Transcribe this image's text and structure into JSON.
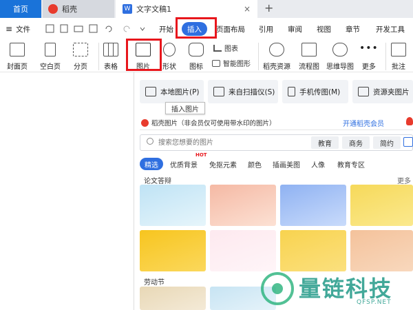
{
  "titlebar": {
    "home_tab": "首页",
    "tabs": [
      {
        "label": "稻壳"
      },
      {
        "label": "文字文稿1",
        "close": "×"
      }
    ],
    "new_tab": "+"
  },
  "menu": {
    "file_label": "文件",
    "items": [
      "开始",
      "插入",
      "页面布局",
      "引用",
      "审阅",
      "视图",
      "章节",
      "开发工具"
    ],
    "active_index": 1
  },
  "ribbon": {
    "buttons": [
      "封面页",
      "空白页",
      "分页",
      "表格",
      "图片",
      "形状",
      "图标",
      "智能图形",
      "稻壳资源",
      "流程图",
      "思维导图",
      "更多",
      "批注"
    ],
    "chart_label": "图表"
  },
  "picture_panel": {
    "sources": [
      "本地图片(P)",
      "来自扫描仪(S)",
      "手机传图(M)",
      "资源夹图片"
    ],
    "tooltip": "插入图片",
    "banner_text": "稻壳图片（非会员仅可使用带水印的图片）",
    "member_link": "开通稻壳会员",
    "search_placeholder": "搜索您想要的图片",
    "search_chips": [
      "教育",
      "商务",
      "简约"
    ],
    "categories": [
      "精选",
      "优质背景",
      "免抠元素",
      "颜色",
      "插画美图",
      "人像",
      "教育专区"
    ],
    "hot_badge": "HOT",
    "section1_title": "论文答辩",
    "more_label": "更多",
    "section2_title": "劳动节"
  },
  "watermark": {
    "brand": "量链科技",
    "domain": "QFSP.NET"
  },
  "colors": {
    "accent": "#2f6fe0",
    "highlight_red": "#e8161c",
    "home_tab_bg": "#1a73d9"
  }
}
